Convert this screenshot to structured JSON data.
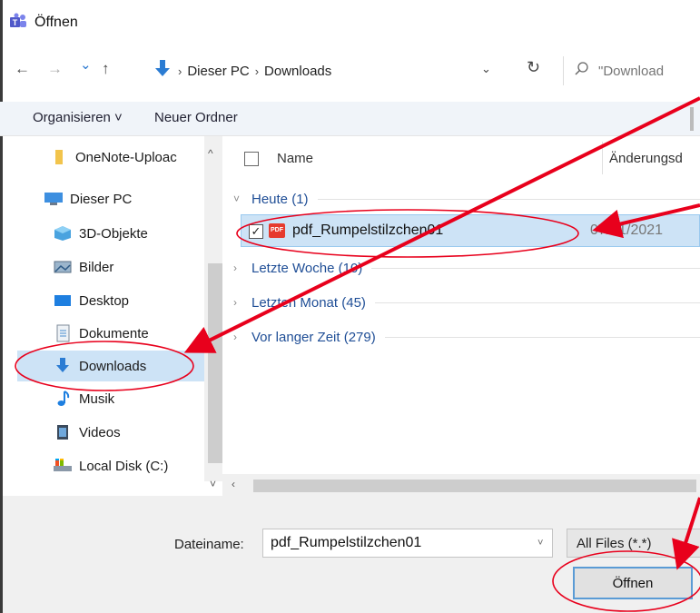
{
  "window": {
    "title": "Öffnen",
    "title_icon": "teams-icon"
  },
  "address": {
    "back_icon": "←",
    "forward_icon": "→",
    "recent_icon": "⌄",
    "up_icon": "↑",
    "crumbs": [
      "Dieser PC",
      "Downloads"
    ],
    "separator": "›",
    "dropdown_icon": "⌄",
    "refresh_icon": "↻",
    "search_placeholder": "\"Download"
  },
  "toolbar": {
    "organize_label": "Organisieren ˅",
    "new_folder_label": "Neuer Ordner"
  },
  "sidebar": {
    "items": [
      {
        "label": "OneNote-Uploac",
        "icon": "folder-icon"
      },
      {
        "label": "Dieser PC",
        "icon": "computer-icon"
      },
      {
        "label": "3D-Objekte",
        "icon": "3d-objects-icon"
      },
      {
        "label": "Bilder",
        "icon": "pictures-icon"
      },
      {
        "label": "Desktop",
        "icon": "desktop-icon"
      },
      {
        "label": "Dokumente",
        "icon": "documents-icon"
      },
      {
        "label": "Downloads",
        "icon": "download-icon",
        "selected": true
      },
      {
        "label": "Musik",
        "icon": "music-icon"
      },
      {
        "label": "Videos",
        "icon": "videos-icon"
      },
      {
        "label": "Local Disk (C:)",
        "icon": "local-disk-icon"
      }
    ]
  },
  "filelist": {
    "header": {
      "name": "Name",
      "date": "Änderungsd"
    },
    "groups": [
      {
        "label": "Heute (1)",
        "expanded": true
      },
      {
        "label": "Letzte Woche (10)",
        "expanded": false
      },
      {
        "label": "Letzten Monat (45)",
        "expanded": false
      },
      {
        "label": "Vor langer Zeit (279)",
        "expanded": false
      }
    ],
    "file": {
      "name": "pdf_Rumpelstilzchen01",
      "date": "07/01/2021",
      "icon_text": "PDF",
      "checked": true
    }
  },
  "bottom": {
    "filename_label": "Dateiname:",
    "filename_value": "pdf_Rumpelstilzchen01",
    "filetype_value": "All Files (*.*)",
    "open_label": "Öffnen"
  },
  "colors": {
    "accent": "#1f4e96",
    "selection": "#cde3f6",
    "annotation": "#e8001c"
  }
}
